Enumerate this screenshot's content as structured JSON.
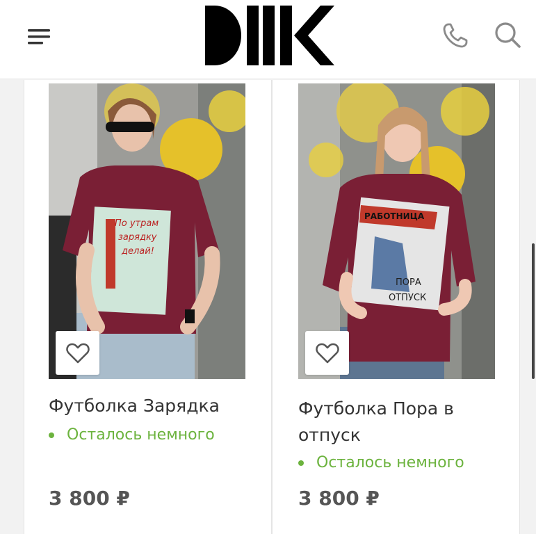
{
  "header": {
    "logo_alt": "DIIK",
    "menu_icon": "hamburger-menu-icon",
    "phone_icon": "phone-icon",
    "search_icon": "search-icon"
  },
  "colors": {
    "accent_green": "#6cb33e",
    "price_text": "#555555",
    "shirt_burgundy": "#7a1f35"
  },
  "products": [
    {
      "title": "Футболка Зарядка",
      "stock": "Осталось немного",
      "price": "3 800 ₽",
      "print_text": "По утрам зарядку делай!",
      "favorite_icon": "heart-icon"
    },
    {
      "title": "Футболка Пора в отпуск",
      "stock": "Осталось немного",
      "price": "3 800 ₽",
      "print_text": "РАБОТНИЦА ПОРА В ОТПУСК",
      "favorite_icon": "heart-icon"
    }
  ]
}
